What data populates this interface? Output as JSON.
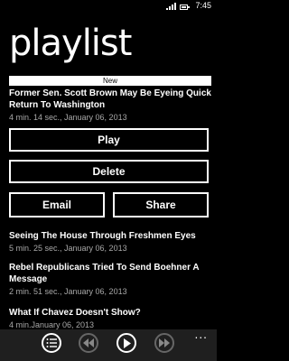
{
  "status": {
    "time": "7:45"
  },
  "page": {
    "title": "playlist"
  },
  "banner": {
    "label": "New"
  },
  "featured": {
    "title": "Former Sen. Scott Brown May Be Eyeing Quick Return To Washington",
    "meta": "4 min. 14 sec., January 06, 2013"
  },
  "actions": {
    "play": "Play",
    "delete": "Delete",
    "email": "Email",
    "share": "Share"
  },
  "items": [
    {
      "title": "Seeing The House Through Freshmen Eyes",
      "meta": "5 min. 25 sec., January 06, 2013"
    },
    {
      "title": "Rebel Republicans Tried To Send Boehner A Message",
      "meta": "2 min. 51 sec., January 06, 2013"
    },
    {
      "title": "What If Chavez Doesn't Show?",
      "meta": "4 min.January 06, 2013"
    }
  ],
  "app_bar": {
    "more": "..."
  }
}
